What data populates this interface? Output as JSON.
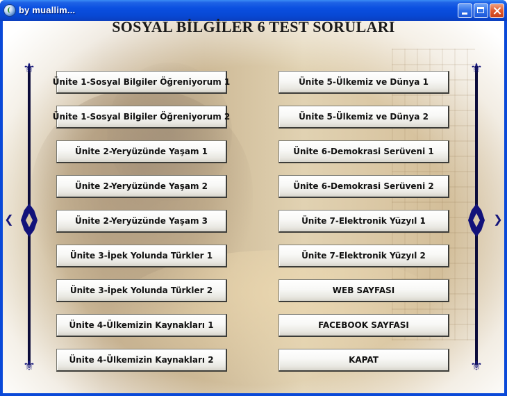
{
  "window": {
    "title": "by muallim...",
    "heading": "SOSYAL BİLGİLER 6 TEST SORULARI"
  },
  "buttons_left": [
    {
      "label": "Ünite 1-Sosyal Bilgiler Öğreniyorum 1"
    },
    {
      "label": "Ünite 1-Sosyal Bilgiler Öğreniyorum 2"
    },
    {
      "label": "Ünite 2-Yeryüzünde Yaşam 1"
    },
    {
      "label": "Ünite 2-Yeryüzünde Yaşam 2"
    },
    {
      "label": "Ünite 2-Yeryüzünde Yaşam 3"
    },
    {
      "label": "Ünite 3-İpek Yolunda Türkler 1"
    },
    {
      "label": "Ünite 3-İpek Yolunda Türkler 2"
    },
    {
      "label": "Ünite 4-Ülkemizin Kaynakları 1"
    },
    {
      "label": "Ünite 4-Ülkemizin Kaynakları 2"
    }
  ],
  "buttons_right": [
    {
      "label": "Ünite 5-Ülkemiz ve Dünya 1"
    },
    {
      "label": "Ünite 5-Ülkemiz ve Dünya 2"
    },
    {
      "label": "Ünite 6-Demokrasi Serüveni 1"
    },
    {
      "label": "Ünite 6-Demokrasi Serüveni 2"
    },
    {
      "label": "Ünite 7-Elektronik Yüzyıl 1"
    },
    {
      "label": "Ünite 7-Elektronik Yüzyıl 2"
    },
    {
      "label": "WEB SAYFASI"
    },
    {
      "label": "FACEBOOK SAYFASI"
    },
    {
      "label": "KAPAT"
    }
  ],
  "colors": {
    "titlebar": "#0a4fe0",
    "ornament": "#12127a",
    "background": "#d8c8a8"
  }
}
